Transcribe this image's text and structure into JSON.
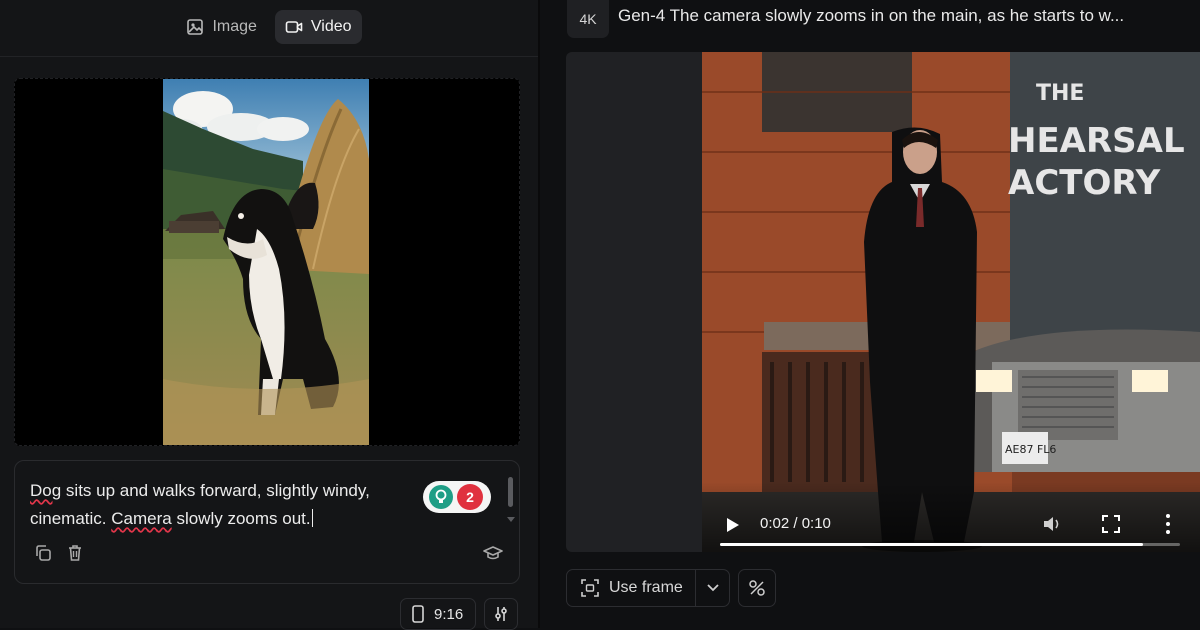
{
  "left_panel": {
    "tabs": [
      {
        "label": "Image",
        "icon": "image-icon",
        "active": false
      },
      {
        "label": "Video",
        "icon": "video-camera-icon",
        "active": true
      }
    ],
    "prompt": {
      "word_1": "Dog",
      "text_1": " sits up and walks forward, slightly windy, cinematic. ",
      "word_2": "Camera",
      "text_2": " slowly zooms out."
    },
    "assistant_badge": {
      "icon": "lightbulb-icon",
      "count": "2",
      "accent": "#1f9e86",
      "badge_color": "#e0313f"
    },
    "tools": [
      {
        "icon": "copy-icon"
      },
      {
        "icon": "trash-icon"
      },
      {
        "icon": "graduation-cap-icon"
      }
    ],
    "aspect_ratio": {
      "icon": "phone-portrait-icon",
      "label": "9:16"
    },
    "settings_icon": "sliders-icon"
  },
  "right_panel": {
    "resolution_badge": "4K",
    "generation_title": "Gen-4 The camera slowly zooms in on the main, as he starts to w...",
    "video": {
      "current_time": "0:02",
      "duration": "0:10",
      "time_display": "0:02 / 0:10",
      "progress_fraction": 0.92,
      "sign_lines": [
        "THE",
        "HEARSAL",
        "ACTORY"
      ],
      "plate": "AE87 FL6"
    },
    "use_frame_button": {
      "label": "Use frame",
      "icon": "frame-capture-icon"
    }
  }
}
